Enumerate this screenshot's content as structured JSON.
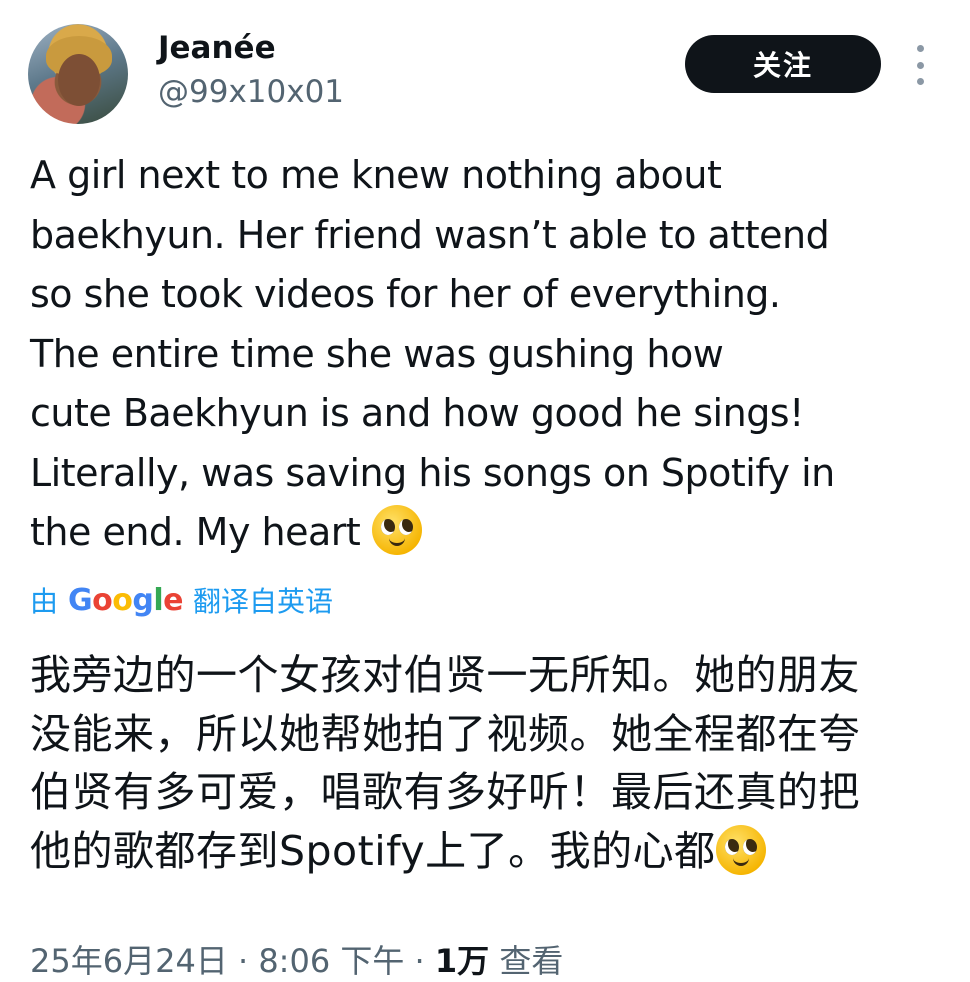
{
  "author": {
    "name": "Jeanée",
    "handle": "@99x10x01"
  },
  "follow_label": "关注",
  "more_icon": "more-vertical-icon",
  "tweet_lines": [
    "A girl next to me knew nothing about",
    "baekhyun. Her friend wasn’t able to attend",
    "so she took videos for her of everything.",
    "The entire time she was gushing how",
    "cute Baekhyun is and how good he sings!",
    "Literally, was saving his songs on Spotify in",
    "the end. My heart"
  ],
  "emoji_icon": "pleading-face-emoji",
  "translation": {
    "prefix": "由",
    "brand": "Google",
    "suffix": "翻译自英语"
  },
  "translated_lines": [
    "我旁边的一个女孩对伯贤一无所知。她的朋友",
    "没能来，所以她帮她拍了视频。她全程都在夸",
    "伯贤有多可爱，唱歌有多好听！最后还真的把",
    "他的歌都存到Spotify上了。我的心都"
  ],
  "meta": {
    "timestamp": "25年6月24日 · 8:06 下午 · ",
    "views_count": "1万",
    "views_label": " 查看"
  },
  "colors": {
    "link": "#1d9bf0",
    "secondary_text": "#536471",
    "button_bg": "#0f1419"
  }
}
